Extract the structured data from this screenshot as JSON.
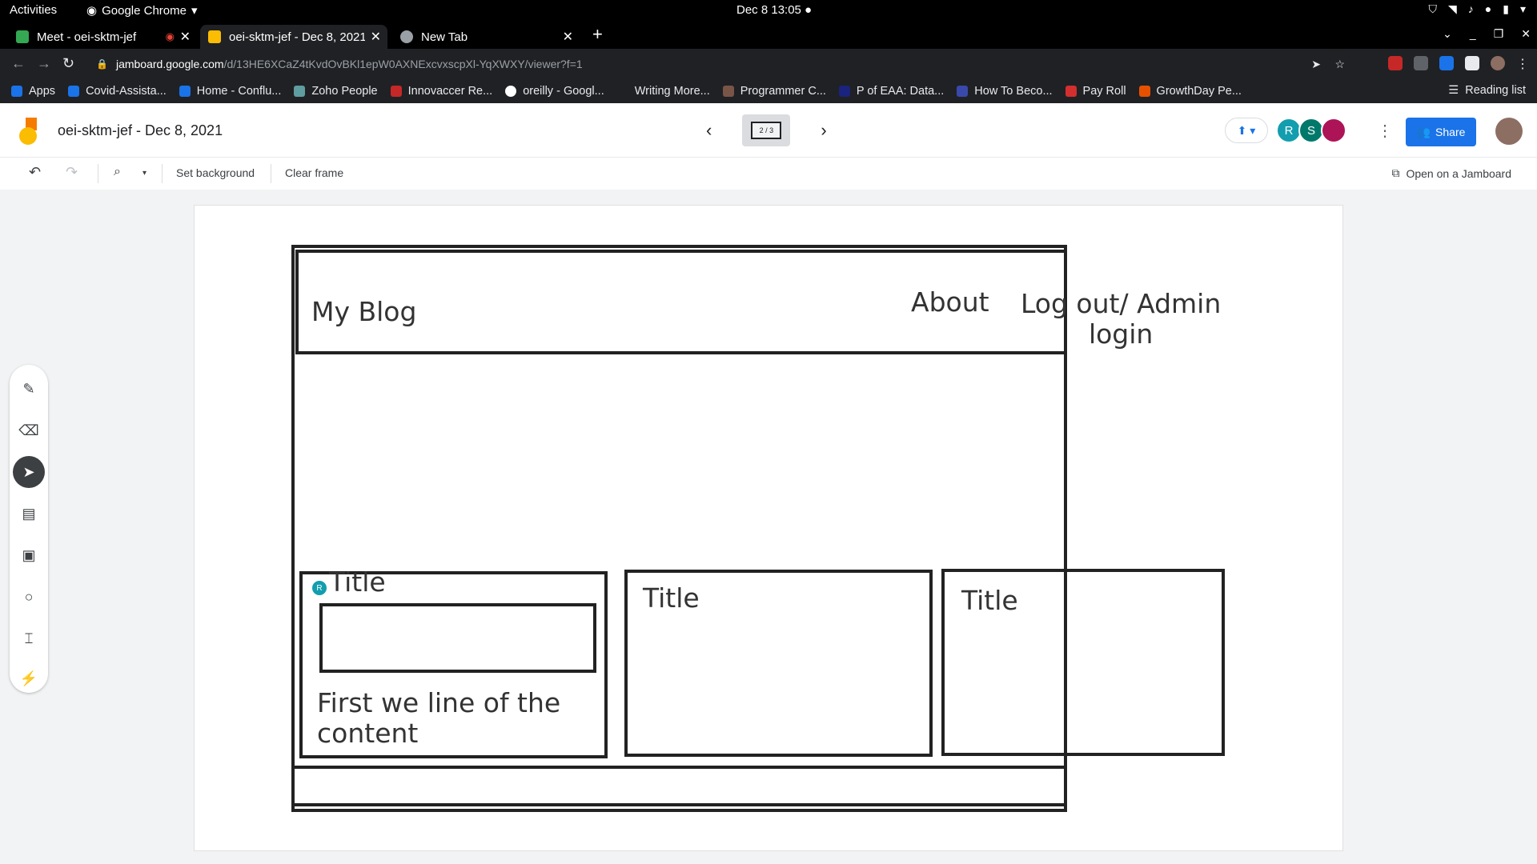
{
  "os": {
    "activities": "Activities",
    "app_name": "Google Chrome",
    "clock": "Dec 8  13:05"
  },
  "tabs": [
    {
      "label": "Meet - oei-sktm-jef",
      "color": "#34a853"
    },
    {
      "label": "oei-sktm-jef - Dec 8, 2021",
      "color": "#fbbc04"
    },
    {
      "label": "New Tab",
      "color": "#9aa0a6"
    }
  ],
  "omnibox": {
    "host": "jamboard.google.com",
    "path": "/d/13HE6XCaZ4tKvdOvBKl1epW0AXNExcvxscpXl-YqXWXY/viewer?f=1"
  },
  "bookmarks": {
    "apps": "Apps",
    "items": [
      {
        "label": "Covid-Assista...",
        "color": "#1a73e8"
      },
      {
        "label": "Home - Conflu...",
        "color": "#1a73e8"
      },
      {
        "label": "Zoho People",
        "color": "#5f9ea0"
      },
      {
        "label": "Innovaccer Re...",
        "color": "#c62828"
      },
      {
        "label": "oreilly - Googl...",
        "color": "#ffffff"
      },
      {
        "label": "Writing More...",
        "color": "#202124"
      },
      {
        "label": "Programmer C...",
        "color": "#795548"
      },
      {
        "label": "P of EAA: Data...",
        "color": "#1a237e"
      },
      {
        "label": "How To Beco...",
        "color": "#3949ab"
      },
      {
        "label": "Pay Roll",
        "color": "#d32f2f"
      },
      {
        "label": "GrowthDay Pe...",
        "color": "#e65100"
      }
    ],
    "reading_list": "Reading list"
  },
  "jamboard": {
    "title": "oei-sktm-jef - Dec 8, 2021",
    "frame_indicator": "2 / 3",
    "avatars": [
      {
        "letter": "R",
        "color": "#129eaf"
      },
      {
        "letter": "S",
        "color": "#00796b"
      },
      {
        "letter": "",
        "color": "#ad1457"
      }
    ],
    "share_label": "Share",
    "set_background": "Set background",
    "clear_frame": "Clear frame",
    "open_on_jamboard": "Open on a Jamboard"
  },
  "tools": [
    "pen-icon",
    "eraser-icon",
    "select-icon",
    "sticky-note-icon",
    "image-icon",
    "circle-icon",
    "text-box-icon",
    "laser-icon"
  ],
  "wireframe": {
    "brand": "My Blog",
    "nav_about": "About",
    "nav_login": "Log out/ Admin\nlogin",
    "card1_title": "Title",
    "card1_text": "First we line of the\ncontent",
    "card2_title": "Title",
    "card3_title": "Title",
    "cursor_label": "R"
  }
}
